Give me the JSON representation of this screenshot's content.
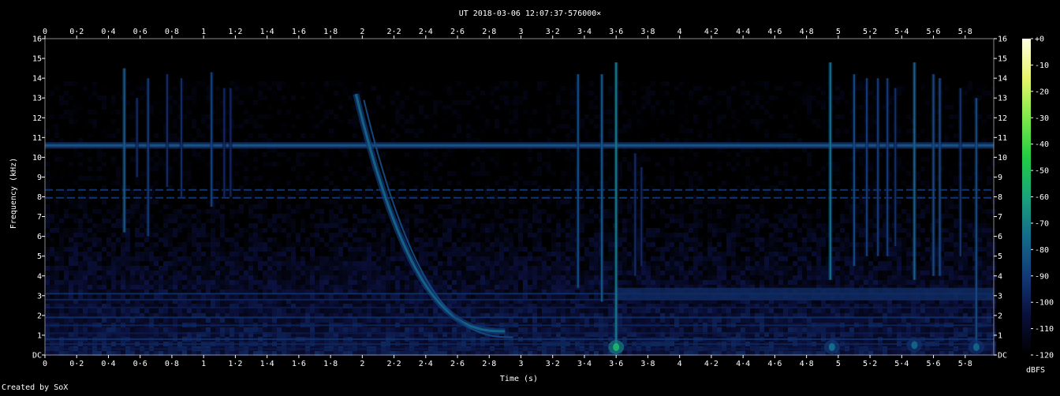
{
  "header": {
    "title": "UT 2018-03-06 12:07:37·576000×"
  },
  "footer": {
    "credit": "Created by SoX"
  },
  "chart_data": {
    "type": "heatmap",
    "title": "UT 2018-03-06 12:07:37·576000×",
    "xlabel": "Time (s)",
    "ylabel": "Frequency (kHz)",
    "xlim": [
      0,
      5.98
    ],
    "ylim": [
      0,
      16
    ],
    "x_ticks": [
      {
        "v": 0,
        "label": "0"
      },
      {
        "v": 0.2,
        "label": "0·2"
      },
      {
        "v": 0.4,
        "label": "0·4"
      },
      {
        "v": 0.6,
        "label": "0·6"
      },
      {
        "v": 0.8,
        "label": "0·8"
      },
      {
        "v": 1,
        "label": "1"
      },
      {
        "v": 1.2,
        "label": "1·2"
      },
      {
        "v": 1.4,
        "label": "1·4"
      },
      {
        "v": 1.6,
        "label": "1·6"
      },
      {
        "v": 1.8,
        "label": "1·8"
      },
      {
        "v": 2,
        "label": "2"
      },
      {
        "v": 2.2,
        "label": "2·2"
      },
      {
        "v": 2.4,
        "label": "2·4"
      },
      {
        "v": 2.6,
        "label": "2·6"
      },
      {
        "v": 2.8,
        "label": "2·8"
      },
      {
        "v": 3,
        "label": "3"
      },
      {
        "v": 3.2,
        "label": "3·2"
      },
      {
        "v": 3.4,
        "label": "3·4"
      },
      {
        "v": 3.6,
        "label": "3·6"
      },
      {
        "v": 3.8,
        "label": "3·8"
      },
      {
        "v": 4,
        "label": "4"
      },
      {
        "v": 4.2,
        "label": "4·2"
      },
      {
        "v": 4.4,
        "label": "4·4"
      },
      {
        "v": 4.6,
        "label": "4·6"
      },
      {
        "v": 4.8,
        "label": "4·8"
      },
      {
        "v": 5,
        "label": "5"
      },
      {
        "v": 5.2,
        "label": "5·2"
      },
      {
        "v": 5.4,
        "label": "5·4"
      },
      {
        "v": 5.6,
        "label": "5·6"
      },
      {
        "v": 5.8,
        "label": "5·8"
      }
    ],
    "y_ticks": [
      {
        "v": 0,
        "label": "DC"
      },
      {
        "v": 1,
        "label": "1"
      },
      {
        "v": 2,
        "label": "2"
      },
      {
        "v": 3,
        "label": "3"
      },
      {
        "v": 4,
        "label": "4"
      },
      {
        "v": 5,
        "label": "5"
      },
      {
        "v": 6,
        "label": "6"
      },
      {
        "v": 7,
        "label": "7"
      },
      {
        "v": 8,
        "label": "8"
      },
      {
        "v": 9,
        "label": "9"
      },
      {
        "v": 10,
        "label": "10"
      },
      {
        "v": 11,
        "label": "11"
      },
      {
        "v": 12,
        "label": "12"
      },
      {
        "v": 13,
        "label": "13"
      },
      {
        "v": 14,
        "label": "14"
      },
      {
        "v": 15,
        "label": "15"
      },
      {
        "v": 16,
        "label": "16"
      }
    ],
    "colorbar": {
      "label": "dBFS",
      "ticks": [
        "+0",
        "-10",
        "-20",
        "-30",
        "-40",
        "-50",
        "-60",
        "-70",
        "-80",
        "-90",
        "-100",
        "-110",
        "-120"
      ],
      "colors": [
        "#000000",
        "#0a0f3a",
        "#123a78",
        "#146b8a",
        "#1aa37a",
        "#22cc44",
        "#7ee84a",
        "#e6f56a",
        "#ffffe0"
      ]
    },
    "features": {
      "tone_khz": 10.6,
      "faint_tones_khz": [
        8.35,
        7.95
      ],
      "whistler": {
        "t_start": 1.96,
        "t_end": 2.9,
        "f_start_khz": 13.2,
        "f_end_khz": 1.2
      },
      "clicks": [
        {
          "t": 0.5,
          "f_top": 14.5,
          "f_bottom": 6.2,
          "level": -80
        },
        {
          "t": 0.58,
          "f_top": 13.0,
          "f_bottom": 9.0,
          "level": -95
        },
        {
          "t": 0.65,
          "f_top": 14.0,
          "f_bottom": 6.0,
          "level": -90
        },
        {
          "t": 0.77,
          "f_top": 14.2,
          "f_bottom": 8.5,
          "level": -95
        },
        {
          "t": 0.86,
          "f_top": 14.0,
          "f_bottom": 8.0,
          "level": -95
        },
        {
          "t": 1.05,
          "f_top": 14.3,
          "f_bottom": 7.5,
          "level": -88
        },
        {
          "t": 1.13,
          "f_top": 13.5,
          "f_bottom": 8.0,
          "level": -96
        },
        {
          "t": 1.17,
          "f_top": 13.5,
          "f_bottom": 8.0,
          "level": -96
        },
        {
          "t": 3.36,
          "f_top": 14.2,
          "f_bottom": 3.4,
          "level": -85
        },
        {
          "t": 3.51,
          "f_top": 14.2,
          "f_bottom": 2.7,
          "level": -82
        },
        {
          "t": 3.6,
          "f_top": 14.8,
          "f_bottom": 0.2,
          "level": -72
        },
        {
          "t": 3.72,
          "f_top": 10.2,
          "f_bottom": 4.0,
          "level": -95
        },
        {
          "t": 3.76,
          "f_top": 9.5,
          "f_bottom": 4.5,
          "level": -96
        },
        {
          "t": 4.95,
          "f_top": 14.8,
          "f_bottom": 3.8,
          "level": -74
        },
        {
          "t": 5.1,
          "f_top": 14.2,
          "f_bottom": 4.5,
          "level": -86
        },
        {
          "t": 5.18,
          "f_top": 14.0,
          "f_bottom": 5.0,
          "level": -90
        },
        {
          "t": 5.25,
          "f_top": 14.0,
          "f_bottom": 5.0,
          "level": -90
        },
        {
          "t": 5.31,
          "f_top": 14.0,
          "f_bottom": 5.0,
          "level": -90
        },
        {
          "t": 5.36,
          "f_top": 13.5,
          "f_bottom": 5.5,
          "level": -94
        },
        {
          "t": 5.48,
          "f_top": 14.8,
          "f_bottom": 3.8,
          "level": -78
        },
        {
          "t": 5.6,
          "f_top": 14.2,
          "f_bottom": 4.0,
          "level": -85
        },
        {
          "t": 5.64,
          "f_top": 14.0,
          "f_bottom": 4.0,
          "level": -86
        },
        {
          "t": 5.77,
          "f_top": 13.5,
          "f_bottom": 5.0,
          "level": -92
        },
        {
          "t": 5.87,
          "f_top": 13.0,
          "f_bottom": 0.2,
          "level": -85
        }
      ],
      "low_freq_bursts": [
        {
          "t": 3.6,
          "f": 0.4,
          "level": -55
        },
        {
          "t": 4.96,
          "f": 0.4,
          "level": -75
        },
        {
          "t": 5.48,
          "f": 0.5,
          "level": -78
        },
        {
          "t": 5.87,
          "f": 0.4,
          "level": -78
        }
      ]
    }
  }
}
